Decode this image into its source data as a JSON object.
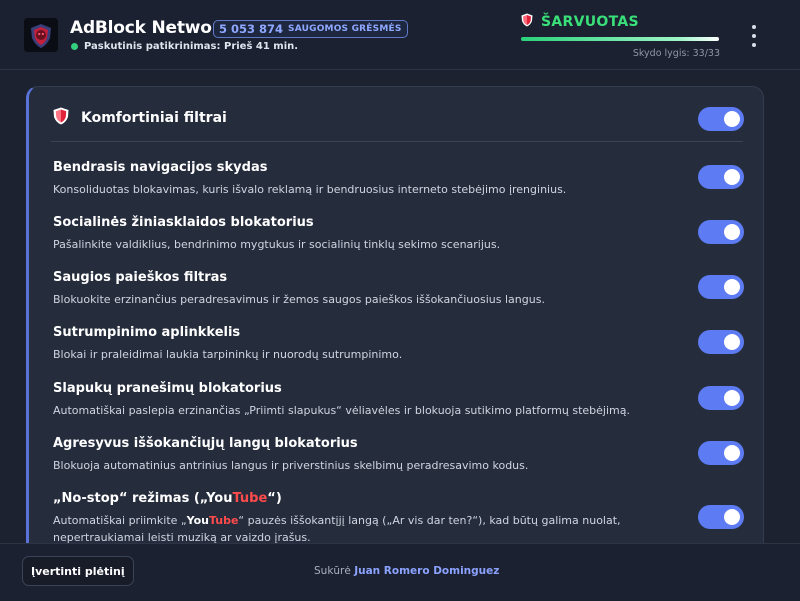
{
  "header": {
    "app_title": "AdBlock Network",
    "blocked_count": "5 053 874",
    "blocked_label": "SAUGOMOS GRĖSMĖS",
    "last_check": "Paskutinis patikrinimas: Prieš 41 min.",
    "status_label": "ŠARVUOTAS",
    "progress_fraction": 1.0,
    "shield_level": "Skydo lygis: 33/33",
    "logo_text": "AdBlock",
    "accent_color": "#5d7bf2",
    "status_color": "#39e07a"
  },
  "card": {
    "title": "Komfortiniai filtrai",
    "master_toggle_on": true,
    "filters": [
      {
        "title": "Bendrasis navigacijos skydas",
        "desc": "Konsoliduotas blokavimas, kuris išvalo reklamą ir bendruosius interneto stebėjimo įrenginius.",
        "on": true
      },
      {
        "title": "Socialinės žiniasklaidos blokatorius",
        "desc": "Pašalinkite valdiklius, bendrinimo mygtukus ir socialinių tinklų sekimo scenarijus.",
        "on": true
      },
      {
        "title": "Saugios paieškos filtras",
        "desc": "Blokuokite erzinančius peradresavimus ir žemos saugos paieškos iššokančiuosius langus.",
        "on": true
      },
      {
        "title": "Sutrumpinimo aplinkkelis",
        "desc": "Blokai ir praleidimai laukia tarpininkų ir nuorodų sutrumpinimo.",
        "on": true
      },
      {
        "title": "Slapukų pranešimų blokatorius",
        "desc": "Automatiškai paslepia erzinančias „Priimti slapukus“ vėliavėles ir blokuoja sutikimo platformų stebėjimą.",
        "on": true
      },
      {
        "title": "Agresyvus iššokančiųjų langų blokatorius",
        "desc": "Blokuoja automatinius antrinius langus ir priverstinius skelbimų peradresavimo kodus.",
        "on": true
      }
    ],
    "nostop": {
      "title_pre": "„No-stop“ režimas („",
      "yt_you": "You",
      "yt_tube": "Tube",
      "title_post": "“)",
      "desc_pre": "Automatiškai priimkite „",
      "desc_yt_you": "You",
      "desc_yt_tube": "Tube",
      "desc_post": "“ pauzės iššokantįjį langą („Ar vis dar ten?“), kad būtų galima nuolat, nepertraukiamai leisti muziką ar vaizdo įrašus.",
      "on": true
    }
  },
  "footer": {
    "rate_button": "Įvertinti plėtinį",
    "credits_prefix": "Sukūrė",
    "author": "Juan Romero Dominguez"
  },
  "icons": {
    "logo": "adblock-logo-icon",
    "status": "shield-icon",
    "card": "shield-icon",
    "menu": "kebab-menu-icon"
  }
}
